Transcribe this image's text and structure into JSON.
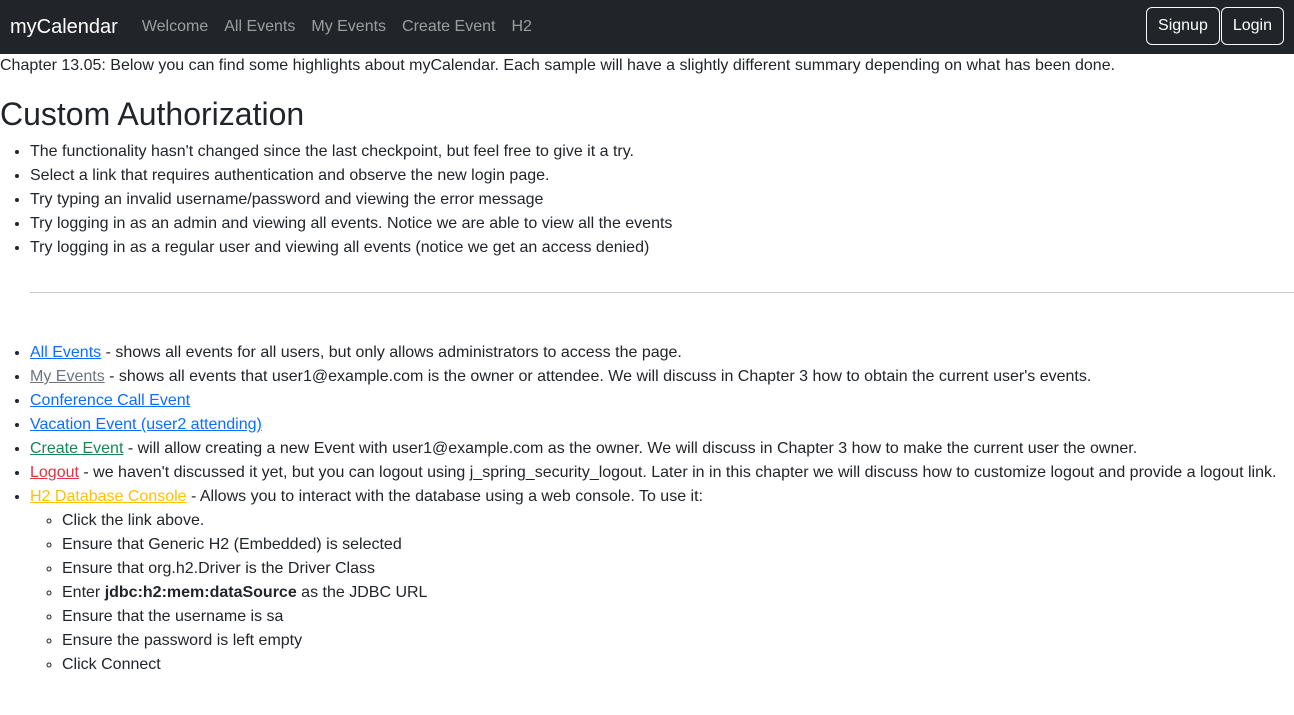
{
  "navbar": {
    "brand": "myCalendar",
    "links": [
      "Welcome",
      "All Events",
      "My Events",
      "Create Event",
      "H2"
    ],
    "signup_label": "Signup",
    "login_label": "Login"
  },
  "intro": "Chapter 13.05: Below you can find some highlights about myCalendar. Each sample will have a slightly different summary depending on what has been done.",
  "section_title": "Custom Authorization",
  "highlights": [
    "The functionality hasn't changed since the last checkpoint, but feel free to give it a try.",
    "Select a link that requires authentication and observe the new login page.",
    "Try typing an invalid username/password and viewing the error message",
    "Try logging in as an admin and viewing all events. Notice we are able to view all the events",
    "Try logging in as a regular user and viewing all events (notice we get an access denied)"
  ],
  "links": [
    {
      "label": "All Events",
      "desc": " - shows all events for all users, but only allows administrators to access the page.",
      "color": "#0d6efd"
    },
    {
      "label": "My Events",
      "desc": " - shows all events that user1@example.com is the owner or attendee. We will discuss in Chapter 3 how to obtain the current user's events.",
      "color": "#6c757d"
    },
    {
      "label": "Conference Call Event",
      "desc": "",
      "color": "#0d6efd"
    },
    {
      "label": "Vacation Event (user2 attending)",
      "desc": "",
      "color": "#0d6efd"
    },
    {
      "label": "Create Event",
      "desc": " - will allow creating a new Event with user1@example.com as the owner. We will discuss in Chapter 3 how to make the current user the owner.",
      "color": "#198754"
    },
    {
      "label": "Logout",
      "desc": " - we haven't discussed it yet, but you can logout using j_spring_security_logout. Later in in this chapter we will discuss how to customize logout and provide a logout link.",
      "color": "#dc3545"
    },
    {
      "label": "H2 Database Console",
      "desc": " - Allows you to interact with the database using a web console. To use it:",
      "color": "#ffc107"
    }
  ],
  "h2_steps": {
    "s1": "Click the link above.",
    "s2": "Ensure that Generic H2 (Embedded) is selected",
    "s3": "Ensure that org.h2.Driver is the Driver Class",
    "s4_pre": "Enter ",
    "s4_bold": "jdbc:h2:mem:dataSource",
    "s4_post": " as the JDBC URL",
    "s5": "Ensure that the username is sa",
    "s6": "Ensure the password is left empty",
    "s7": "Click Connect"
  }
}
